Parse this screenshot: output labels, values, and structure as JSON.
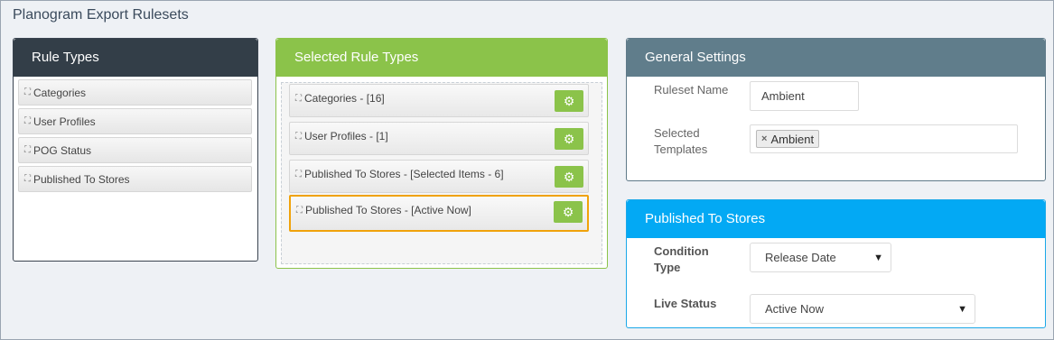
{
  "page": {
    "title": "Planogram Export Rulesets"
  },
  "rule_types": {
    "title": "Rule Types",
    "items": [
      {
        "label": "Categories"
      },
      {
        "label": "User Profiles"
      },
      {
        "label": "POG Status"
      },
      {
        "label": "Published To Stores"
      }
    ]
  },
  "selected_rule_types": {
    "title": "Selected Rule Types",
    "items": [
      {
        "label": "Categories - [16]"
      },
      {
        "label": "User Profiles - [1]"
      },
      {
        "label": "Published To Stores - [Selected Items - 6]"
      },
      {
        "label": "Published To Stores - [Active Now]"
      }
    ]
  },
  "general_settings": {
    "title": "General Settings",
    "ruleset_name_label": "Ruleset Name",
    "ruleset_name_value": "Ambient",
    "selected_templates_label_1": "Selected",
    "selected_templates_label_2": "Templates",
    "template_tag": "Ambient"
  },
  "published_to_stores": {
    "title": "Published To Stores",
    "condition_type_label_1": "Condition",
    "condition_type_label_2": "Type",
    "condition_type_value": "Release Date",
    "live_status_label": "Live Status",
    "live_status_value": "Active Now"
  },
  "icons": {
    "drag": "drag-handle-icon",
    "gear": "gear-icon",
    "chevron": "chevron-down-icon",
    "remove": "close-icon"
  },
  "colors": {
    "rule_types_header": "#333e48",
    "selected_header": "#8bc34a",
    "general_header": "#607d8b",
    "published_header": "#03a9f4",
    "active_border": "#f0a20a"
  }
}
